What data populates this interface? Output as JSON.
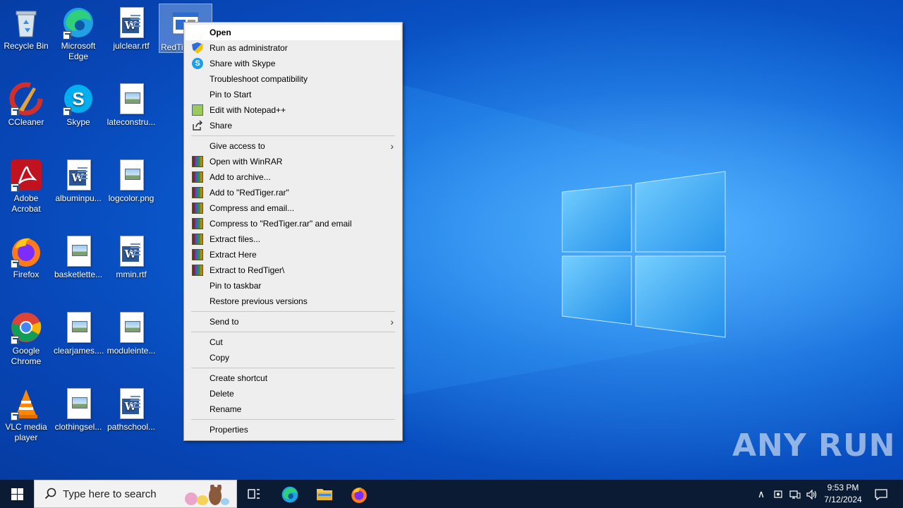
{
  "desktop": {
    "icons": [
      {
        "label": "Recycle Bin",
        "icon": "recycle-bin-icon"
      },
      {
        "label": "Microsoft Edge",
        "icon": "edge-icon"
      },
      {
        "label": "julclear.rtf",
        "icon": "word-doc-icon"
      },
      {
        "label": "RedTig",
        "icon": "exe-file-icon"
      },
      {
        "label": "CCleaner",
        "icon": "ccleaner-icon"
      },
      {
        "label": "Skype",
        "icon": "skype-icon"
      },
      {
        "label": "lateconstru...",
        "icon": "image-file-icon"
      },
      {
        "label": "Adobe Acrobat",
        "icon": "acrobat-icon"
      },
      {
        "label": "albuminpu...",
        "icon": "word-doc-icon"
      },
      {
        "label": "logcolor.png",
        "icon": "image-file-icon"
      },
      {
        "label": "Firefox",
        "icon": "firefox-icon"
      },
      {
        "label": "basketlette...",
        "icon": "image-file-icon"
      },
      {
        "label": "mmin.rtf",
        "icon": "word-doc-icon"
      },
      {
        "label": "Google Chrome",
        "icon": "chrome-icon"
      },
      {
        "label": "clearjames....",
        "icon": "image-file-icon"
      },
      {
        "label": "moduleinte...",
        "icon": "image-file-icon"
      },
      {
        "label": "VLC media player",
        "icon": "vlc-icon"
      },
      {
        "label": "clothingsel...",
        "icon": "image-file-icon"
      },
      {
        "label": "pathschool...",
        "icon": "word-doc-icon"
      }
    ]
  },
  "context_menu": {
    "items": [
      {
        "label": "Open"
      },
      {
        "label": "Run as administrator"
      },
      {
        "label": "Share with Skype"
      },
      {
        "label": "Troubleshoot compatibility"
      },
      {
        "label": "Pin to Start"
      },
      {
        "label": "Edit with Notepad++"
      },
      {
        "label": "Share"
      },
      {
        "label": "Give access to"
      },
      {
        "label": "Open with WinRAR"
      },
      {
        "label": "Add to archive..."
      },
      {
        "label": "Add to \"RedTiger.rar\""
      },
      {
        "label": "Compress and email..."
      },
      {
        "label": "Compress to \"RedTiger.rar\" and email"
      },
      {
        "label": "Extract files..."
      },
      {
        "label": "Extract Here"
      },
      {
        "label": "Extract to RedTiger\\"
      },
      {
        "label": "Pin to taskbar"
      },
      {
        "label": "Restore previous versions"
      },
      {
        "label": "Send to"
      },
      {
        "label": "Cut"
      },
      {
        "label": "Copy"
      },
      {
        "label": "Create shortcut"
      },
      {
        "label": "Delete"
      },
      {
        "label": "Rename"
      },
      {
        "label": "Properties"
      }
    ]
  },
  "taskbar": {
    "search_placeholder": "Type here to search",
    "clock_time": "9:53 PM",
    "clock_date": "7/12/2024"
  },
  "watermark": "ANY RUN",
  "colors": {
    "menu_bg": "#eeeeee",
    "taskbar": "#0b1b33",
    "accent": "#0a63d8"
  }
}
